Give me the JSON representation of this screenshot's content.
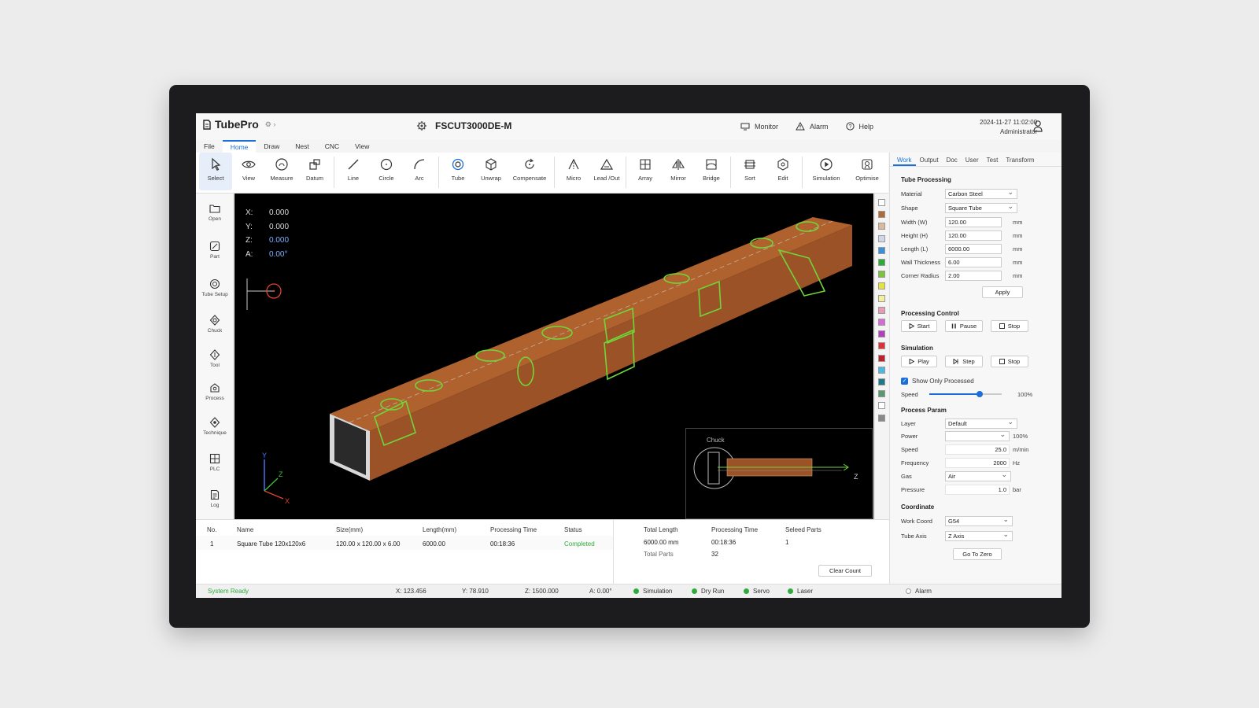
{
  "app": {
    "logo": "TubePro",
    "title": "FSCUT3000DE-M",
    "datetime": "2024-11-27 11:02:00",
    "user": "Administrator"
  },
  "topbar": {
    "monitor": "Monitor",
    "alarm": "Alarm",
    "help": "Help"
  },
  "menu": [
    "File",
    "Home",
    "Draw",
    "Nest",
    "CNC",
    "View"
  ],
  "ribbon": [
    "Select",
    "View",
    "Measure",
    "Datum",
    "Line",
    "Circle",
    "Arc",
    "Tube",
    "Unwrap",
    "Compensate",
    "Micro",
    "Lead /Out",
    "Array",
    "Mirror",
    "Bridge",
    "Sort",
    "Edit",
    "Simulation",
    "Optimise"
  ],
  "lefttools": [
    "Open",
    "Part",
    "Tube Setup",
    "Chuck",
    "Tool",
    "Process",
    "Technique",
    "PLC",
    "Log"
  ],
  "coords": {
    "x_label": "X:",
    "x": "0.000",
    "y_label": "Y:",
    "y": "0.000",
    "z_label": "Z:",
    "z": "0.000",
    "a_label": "A:",
    "a": "0.00°"
  },
  "inset": {
    "label": "Chuck",
    "axis": "Z"
  },
  "axes": {
    "x": "X",
    "y": "Y",
    "z": "Z"
  },
  "swatches": [
    "#ffffff",
    "#b06a3a",
    "#d9b99a",
    "#cfd8e8",
    "#3a8fd9",
    "#2eaa3a",
    "#7cc23e",
    "#e6e23a",
    "#f2f09a",
    "#e89ab4",
    "#d66ad6",
    "#b040c0",
    "#e0303a",
    "#c0202a",
    "#4ab8e0",
    "#1a7a8a",
    "#5a9a6a",
    "#ffffff",
    "#888888"
  ],
  "rtabs": [
    "Work",
    "Output",
    "Doc",
    "User",
    "Test",
    "Transform"
  ],
  "tube_processing": {
    "title": "Tube Processing",
    "material_label": "Material",
    "material": "Carbon Steel",
    "shape_label": "Shape",
    "shape": "Square Tube",
    "width_label": "Width (W)",
    "width": "120.00",
    "height_label": "Height (H)",
    "height": "120.00",
    "length_label": "Length (L)",
    "length": "6000.00",
    "wall_label": "Wall Thickness",
    "wall": "6.00",
    "corner_label": "Corner Radius",
    "corner": "2.00",
    "unit": "mm",
    "apply": "Apply"
  },
  "processing_control": {
    "title": "Processing Control",
    "start": "Start",
    "pause": "Pause",
    "stop": "Stop"
  },
  "simulation": {
    "title": "Simulation",
    "play": "Play",
    "step": "Step",
    "stop": "Stop",
    "show_only": "Show Only Processed",
    "speed_label": "Speed",
    "speed": "100%",
    "speed_fraction": 0.7
  },
  "process_param": {
    "title": "Process Param",
    "layer_label": "Layer",
    "layer": "Default",
    "power_label": "Power",
    "power_unit": "100%",
    "speed_label": "Speed",
    "speed": "25.0",
    "speed_unit": "m/min",
    "freq_label": "Frequency",
    "freq": "2000",
    "freq_unit": "Hz",
    "gas_label": "Gas",
    "gas": "Air",
    "pressure_label": "Pressure",
    "pressure": "1.0",
    "pressure_unit": "bar"
  },
  "coordinate": {
    "title": "Coordinate",
    "work_label": "Work Coord",
    "work": "G54",
    "axis_label": "Tube Axis",
    "axis": "Z Axis",
    "zero": "Go To Zero"
  },
  "table": {
    "headers": [
      "No.",
      "Name",
      "Size(mm)",
      "Length(mm)",
      "Processing Time",
      "Status"
    ],
    "row": [
      "1",
      "Square Tube 120x120x6",
      "120.00 x 120.00 x 6.00",
      "6000.00",
      "00:18:36",
      "Completed"
    ]
  },
  "stats": {
    "total_length_label": "Total Length",
    "total_length": "6000.00 mm",
    "total_parts_label": "Total Parts",
    "time_label": "Processing Time",
    "time": "00:18:36",
    "time_count": "32",
    "selected_label": "Seleed Parts",
    "selected": "1",
    "clear": "Clear Count"
  },
  "status": {
    "ready": "System Ready",
    "x": "X:  123.456",
    "y": "Y:  78.910",
    "z": "Z:  1500.000",
    "a": "A:  0.00°",
    "simulation": "Simulation",
    "dryrun": "Dry Run",
    "servo": "Servo",
    "laser": "Laser",
    "alarm": "Alarm"
  },
  "colors": {
    "accent": "#1a6fd8",
    "ok": "#2dac3b",
    "tube": "#a85a2c",
    "path": "#6fd63a"
  }
}
